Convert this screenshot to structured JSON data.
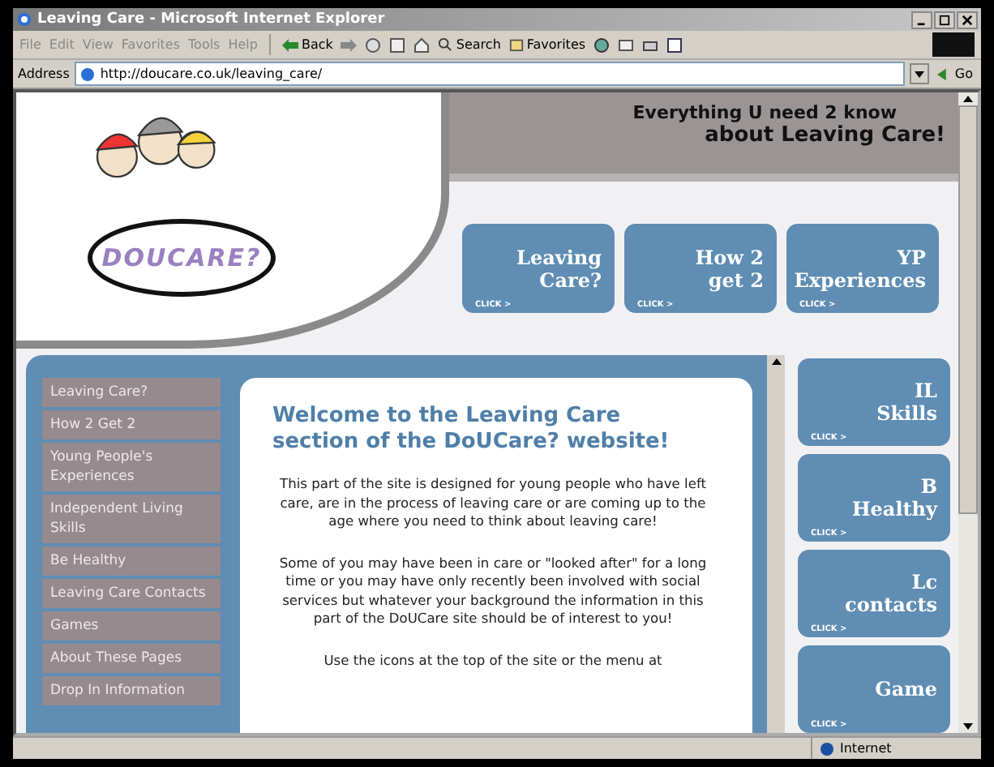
{
  "window": {
    "title": "Leaving Care - Microsoft Internet Explorer"
  },
  "menu": [
    "File",
    "Edit",
    "View",
    "Favorites",
    "Tools",
    "Help"
  ],
  "toolbar": {
    "back": "Back",
    "search": "Search",
    "favorites": "Favorites"
  },
  "address": {
    "label": "Address",
    "url": "http://doucare.co.uk/leaving_care/",
    "go": "Go"
  },
  "header": {
    "logo": "DOUCARE?",
    "slogan_line_1": "Everything U need 2 know",
    "slogan_line_2": "about Leaving Care!"
  },
  "top_tiles": [
    {
      "lines": [
        "Leaving",
        "Care?"
      ],
      "hint": "CLICK >"
    },
    {
      "lines": [
        "How 2",
        "get 2"
      ],
      "hint": "CLICK >"
    },
    {
      "lines": [
        "YP",
        "Experiences"
      ],
      "hint": "CLICK >"
    }
  ],
  "sidebar": {
    "items": [
      "Leaving Care?",
      "How 2 Get 2",
      "Young People's Experiences",
      "Independent Living Skills",
      "Be Healthy",
      "Leaving Care Contacts",
      "Games",
      "About These Pages",
      "Drop In Information"
    ]
  },
  "content": {
    "heading": "Welcome to the Leaving Care section of the DoUCare? website!",
    "paragraphs": [
      "This part of the site is designed for young people who have left care, are in the process of leaving care or are coming up to the age where you need to think about leaving care!",
      "Some of you may have been in care or \"looked after\" for a long time or you may have only recently been involved with social services but whatever your background the information in this part of the DoUCare site should be of interest to you!",
      "Use the icons at the top of the site or the menu at"
    ]
  },
  "side_tiles": [
    {
      "lines": [
        "IL",
        "Skills"
      ],
      "hint": "CLICK >"
    },
    {
      "lines": [
        "B",
        "Healthy"
      ],
      "hint": "CLICK >"
    },
    {
      "lines": [
        "Lc",
        "contacts"
      ],
      "hint": "CLICK >"
    },
    {
      "lines": [
        "Game"
      ],
      "hint": "CLICK >"
    }
  ],
  "status_bar": {
    "zone": "Internet"
  }
}
